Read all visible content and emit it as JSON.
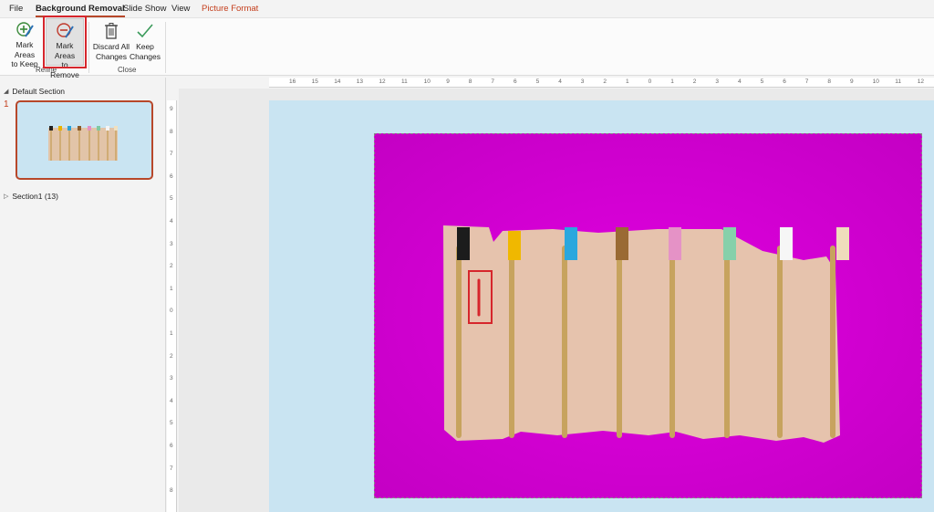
{
  "menu": {
    "tabs": [
      {
        "label": "File"
      },
      {
        "label": "Background Removal"
      },
      {
        "label": "Slide Show"
      },
      {
        "label": "View"
      },
      {
        "label": "Picture Format"
      }
    ]
  },
  "ribbon": {
    "refine_group": {
      "label": "Refine",
      "mark_keep": {
        "line1": "Mark Areas",
        "line2": "to Keep",
        "icon": "pencil-plus-icon"
      },
      "mark_remove": {
        "line1": "Mark Areas",
        "line2": "to Remove",
        "icon": "pencil-minus-icon"
      }
    },
    "close_group": {
      "label": "Close",
      "discard": {
        "line1": "Discard All",
        "line2": "Changes",
        "icon": "trash-icon"
      },
      "keep": {
        "line1": "Keep",
        "line2": "Changes",
        "icon": "checkmark-icon"
      }
    }
  },
  "left_panel": {
    "default_section": "Default Section",
    "slide_number": "1",
    "section1": "Section1 (13)"
  },
  "rulers": {
    "horizontal": [
      "16",
      "15",
      "14",
      "13",
      "12",
      "11",
      "10",
      "9",
      "8",
      "7",
      "6",
      "5",
      "4",
      "3",
      "2",
      "1",
      "0",
      "1",
      "2",
      "3",
      "4",
      "5",
      "6",
      "7",
      "8",
      "9",
      "10",
      "11",
      "12"
    ],
    "vertical": [
      "9",
      "8",
      "7",
      "6",
      "5",
      "4",
      "3",
      "2",
      "1",
      "0",
      "1",
      "2",
      "3",
      "4",
      "5",
      "6",
      "7",
      "8"
    ]
  },
  "colors": {
    "accent": "#b7472a",
    "context_tab": "#c43e1c",
    "removal_overlay": "#d600d6",
    "slide_bg": "#c9e4f2",
    "highlight": "#d6262c"
  }
}
